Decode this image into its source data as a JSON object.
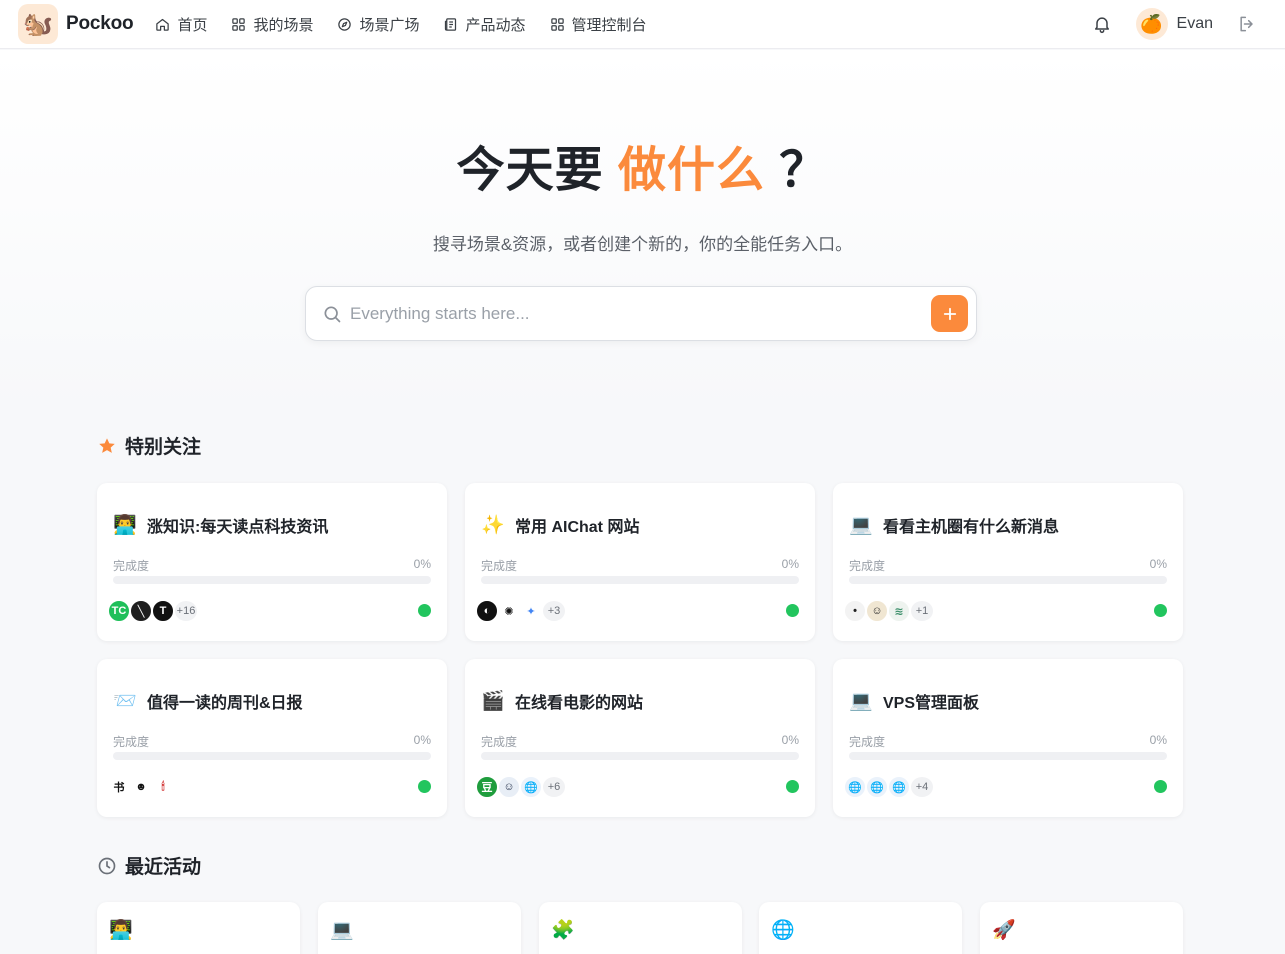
{
  "app": {
    "name": "Pockoo",
    "logo_emoji": "🐿️"
  },
  "nav": [
    {
      "label": "首页",
      "icon": "home-icon"
    },
    {
      "label": "我的场景",
      "icon": "grid-icon"
    },
    {
      "label": "场景广场",
      "icon": "compass-icon"
    },
    {
      "label": "产品动态",
      "icon": "news-icon"
    },
    {
      "label": "管理控制台",
      "icon": "grid-icon"
    }
  ],
  "user": {
    "name": "Evan",
    "avatar_emoji": "🍊"
  },
  "hero": {
    "title_prefix": "今天要",
    "title_accent": "做什么",
    "title_suffix": "？",
    "subtitle": "搜寻场景&资源，或者创建个新的，你的全能任务入口。"
  },
  "search": {
    "placeholder": "Everything starts here...",
    "value": ""
  },
  "colors": {
    "accent": "#fb8a3c",
    "status_ok": "#22c55e"
  },
  "favorites": {
    "title": "特别关注",
    "progress_label": "完成度",
    "cards": [
      {
        "emoji": "👨‍💻",
        "title": "涨知识:每天读点科技资讯",
        "progress": "0%",
        "more": "+16",
        "icons": [
          {
            "text": "TC",
            "bg": "#1fbf5a"
          },
          {
            "text": "╲",
            "bg": "#1f1f1f"
          },
          {
            "text": "T",
            "bg": "#111111"
          }
        ]
      },
      {
        "emoji": "✨",
        "title": "常用 AIChat 网站",
        "progress": "0%",
        "more": "+3",
        "icons": [
          {
            "text": "◐",
            "bg": "#111111"
          },
          {
            "text": "✺",
            "bg": "#ffffff",
            "fg": "#111111"
          },
          {
            "text": "✦",
            "bg": "#ffffff",
            "fg": "#4285f4"
          }
        ]
      },
      {
        "emoji": "💻",
        "title": "看看主机圈有什么新消息",
        "progress": "0%",
        "more": "+1",
        "icons": [
          {
            "text": "•",
            "bg": "#f3f3f3",
            "fg": "#222222"
          },
          {
            "text": "☺",
            "bg": "#f0e6d2",
            "fg": "#222222"
          },
          {
            "text": "≋",
            "bg": "#eef3ef",
            "fg": "#3d8f6b"
          }
        ]
      },
      {
        "emoji": "📨",
        "title": "值得一读的周刊&日报",
        "progress": "0%",
        "more": "",
        "icons": [
          {
            "text": "书",
            "bg": "#ffffff",
            "fg": "#111111"
          },
          {
            "text": "☻",
            "bg": "#ffffff",
            "fg": "#111111"
          },
          {
            "text": "🕯",
            "bg": "#ffffff",
            "fg": "#d12d2d"
          }
        ]
      },
      {
        "emoji": "🎬",
        "title": "在线看电影的网站",
        "progress": "0%",
        "more": "+6",
        "icons": [
          {
            "text": "豆",
            "bg": "#1f9d3d"
          },
          {
            "text": "☺",
            "bg": "#e8eef6",
            "fg": "#1d2a44"
          },
          {
            "text": "🌐",
            "bg": "#eaf2fb",
            "fg": "#2f6fd6"
          }
        ]
      },
      {
        "emoji": "💻",
        "title": "VPS管理面板",
        "progress": "0%",
        "more": "+4",
        "icons": [
          {
            "text": "🌐",
            "bg": "#eaf2fb",
            "fg": "#2f6fd6"
          },
          {
            "text": "🌐",
            "bg": "#eaf2fb",
            "fg": "#2f6fd6"
          },
          {
            "text": "🌐",
            "bg": "#eaf2fb",
            "fg": "#2f6fd6"
          }
        ]
      }
    ]
  },
  "recent": {
    "title": "最近活动",
    "cards": [
      {
        "emoji": "👨‍💻"
      },
      {
        "emoji": "💻"
      },
      {
        "emoji": "🧩"
      },
      {
        "emoji": "🌐"
      },
      {
        "emoji": "🚀"
      }
    ]
  }
}
